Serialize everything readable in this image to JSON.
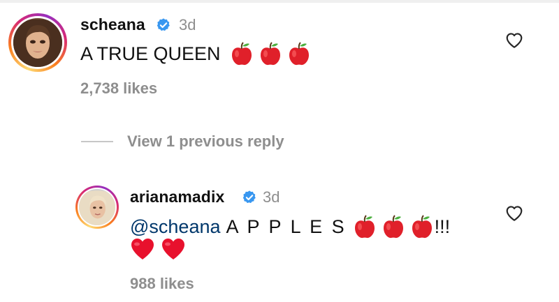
{
  "comments": [
    {
      "username": "scheana",
      "verified": true,
      "time": "3d",
      "text": "A TRUE QUEEN",
      "emoji": [
        "red-apple",
        "red-apple",
        "red-apple"
      ],
      "likes": "2,738 likes"
    }
  ],
  "view_replies_label": "View 1 previous reply",
  "reply": {
    "username": "arianamadix",
    "verified": true,
    "time": "3d",
    "mention": "@scheana",
    "text": "A P P L E S",
    "emoji": [
      "red-apple",
      "red-apple",
      "red-apple"
    ],
    "suffix": "!!!",
    "line2_emoji": [
      "red-heart",
      "red-heart"
    ],
    "likes": "988 likes"
  },
  "colors": {
    "verified_badge": "#3897f0",
    "secondary_text": "#8e8e8e",
    "mention": "#00376b",
    "apple": "#e0202a",
    "heart": "#e8112d"
  }
}
